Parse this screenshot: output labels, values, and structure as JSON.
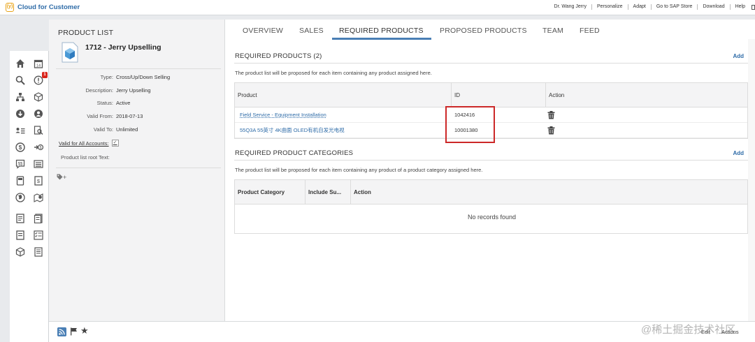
{
  "topbar": {
    "logo_glyph": "(y)",
    "app_name": "Cloud for Customer",
    "links": [
      "Dr. Wang Jerry",
      "Personalize",
      "Adapt",
      "Go to SAP Store",
      "Download",
      "Help"
    ]
  },
  "leftnav": {
    "badge_count": "1",
    "icons": [
      "home-icon",
      "calendar-icon",
      "search-icon",
      "alert-icon",
      "org-chart-icon",
      "cube-icon",
      "download-icon",
      "person-icon",
      "people-list-icon",
      "search-doc-icon",
      "dollar-icon",
      "transfer-icon",
      "pricing-icon",
      "list-icon",
      "device-icon",
      "invoice-icon",
      "globe-icon",
      "map-pin-icon",
      "document-icon",
      "report-icon",
      "checklist-icon",
      "task-list-icon",
      "product-icon",
      "notes-icon"
    ]
  },
  "detail": {
    "section_title": "PRODUCT LIST",
    "object_title": "1712 - Jerry Upselling",
    "fields": [
      {
        "label": "Type:",
        "value": "Cross/Up/Down Selling"
      },
      {
        "label": "Description:",
        "value": "Jerry Upselling"
      },
      {
        "label": "Status:",
        "value": "Active"
      },
      {
        "label": "Valid From:",
        "value": "2018-07-13"
      },
      {
        "label": "Valid To:",
        "value": "Unlimited"
      }
    ],
    "valid_all_label": "Valid for All Accounts:",
    "valid_all_checked": true,
    "root_text_label": "Product list root Text:",
    "tag_add": "+"
  },
  "tabs": [
    "OVERVIEW",
    "SALES",
    "REQUIRED PRODUCTS",
    "PROPOSED PRODUCTS",
    "TEAM",
    "FEED"
  ],
  "active_tab": "REQUIRED PRODUCTS",
  "required_products": {
    "title": "REQUIRED PRODUCTS (2)",
    "add_label": "Add",
    "description": "The product list will be proposed for each item containing any product assigned here.",
    "columns": [
      "Product",
      "ID",
      "Action"
    ],
    "rows": [
      {
        "product": "Field Service - Equipment Installation",
        "id": "1042416"
      },
      {
        "product": "55Q3A 55英寸 4K曲面 OLED有机自发光电视",
        "id": "10001380"
      }
    ]
  },
  "required_categories": {
    "title": "REQUIRED PRODUCT CATEGORIES",
    "add_label": "Add",
    "description": "The product list will be proposed for each item containing any product of a product category assigned here.",
    "columns": [
      "Product Category",
      "Include Su...",
      "Action"
    ],
    "empty_text": "No records found"
  },
  "bottombar": {
    "edit_label": "Edit",
    "actions_label": "Actions"
  },
  "watermark": "@稀土掘金技术社区",
  "colors": {
    "brand_blue": "#2f6ca8",
    "logo_orange": "#e8a317",
    "tab_underline": "#4a7fb5",
    "highlight_red": "#cc2828",
    "badge_red": "#d9251c"
  }
}
